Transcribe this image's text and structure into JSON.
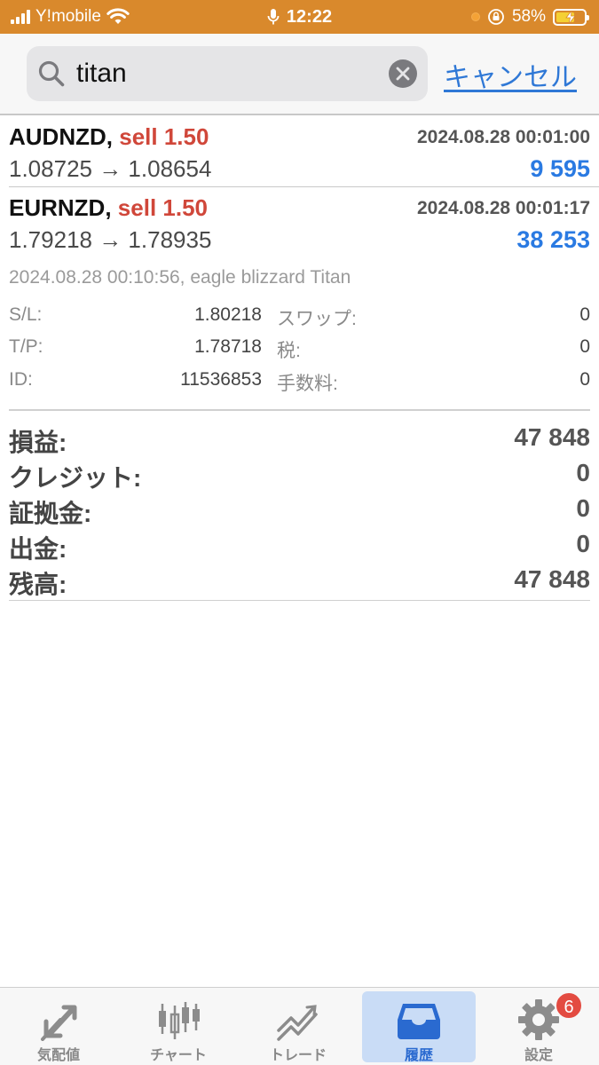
{
  "status_bar": {
    "carrier": "Y!mobile",
    "time": "12:22",
    "battery": "58%"
  },
  "search": {
    "value": "titan",
    "cancel_label": "キャンセル"
  },
  "orders": [
    {
      "symbol": "AUDNZD,",
      "side": "sell 1.50",
      "time": "2024.08.28 00:01:00",
      "prices": "1.08725 → 1.08654",
      "profit": "9 595"
    },
    {
      "symbol": "EURNZD,",
      "side": "sell 1.50",
      "time": "2024.08.28 00:01:17",
      "prices": "1.79218 → 1.78935",
      "profit": "38 253"
    }
  ],
  "detail": {
    "header": "2024.08.28 00:10:56, eagle blizzard Titan",
    "sl_label": "S/L:",
    "sl_value": "1.80218",
    "tp_label": "T/P:",
    "tp_value": "1.78718",
    "id_label": "ID:",
    "id_value": "11536853",
    "swap_label": "スワップ:",
    "swap_value": "0",
    "tax_label": "税:",
    "tax_value": "0",
    "fee_label": "手数料:",
    "fee_value": "0"
  },
  "summary": [
    {
      "label": "損益:",
      "value": "47 848"
    },
    {
      "label": "クレジット:",
      "value": "0"
    },
    {
      "label": "証拠金:",
      "value": "0"
    },
    {
      "label": "出金:",
      "value": "0"
    },
    {
      "label": "残高:",
      "value": "47 848"
    }
  ],
  "tabs": [
    {
      "label": "気配値",
      "icon": "quotes-arrows-icon"
    },
    {
      "label": "チャート",
      "icon": "candlestick-chart-icon"
    },
    {
      "label": "トレード",
      "icon": "trade-chart-icon"
    },
    {
      "label": "履歴",
      "icon": "history-inbox-icon",
      "active": true
    },
    {
      "label": "設定",
      "icon": "gear-icon",
      "badge": "6"
    }
  ],
  "colors": {
    "status_bar": "#d9892c",
    "sell": "#d0473a",
    "profit": "#2a7ae2",
    "link": "#2f78d6",
    "active_tab_bg": "#c9dcf6",
    "badge": "#e34b41"
  }
}
